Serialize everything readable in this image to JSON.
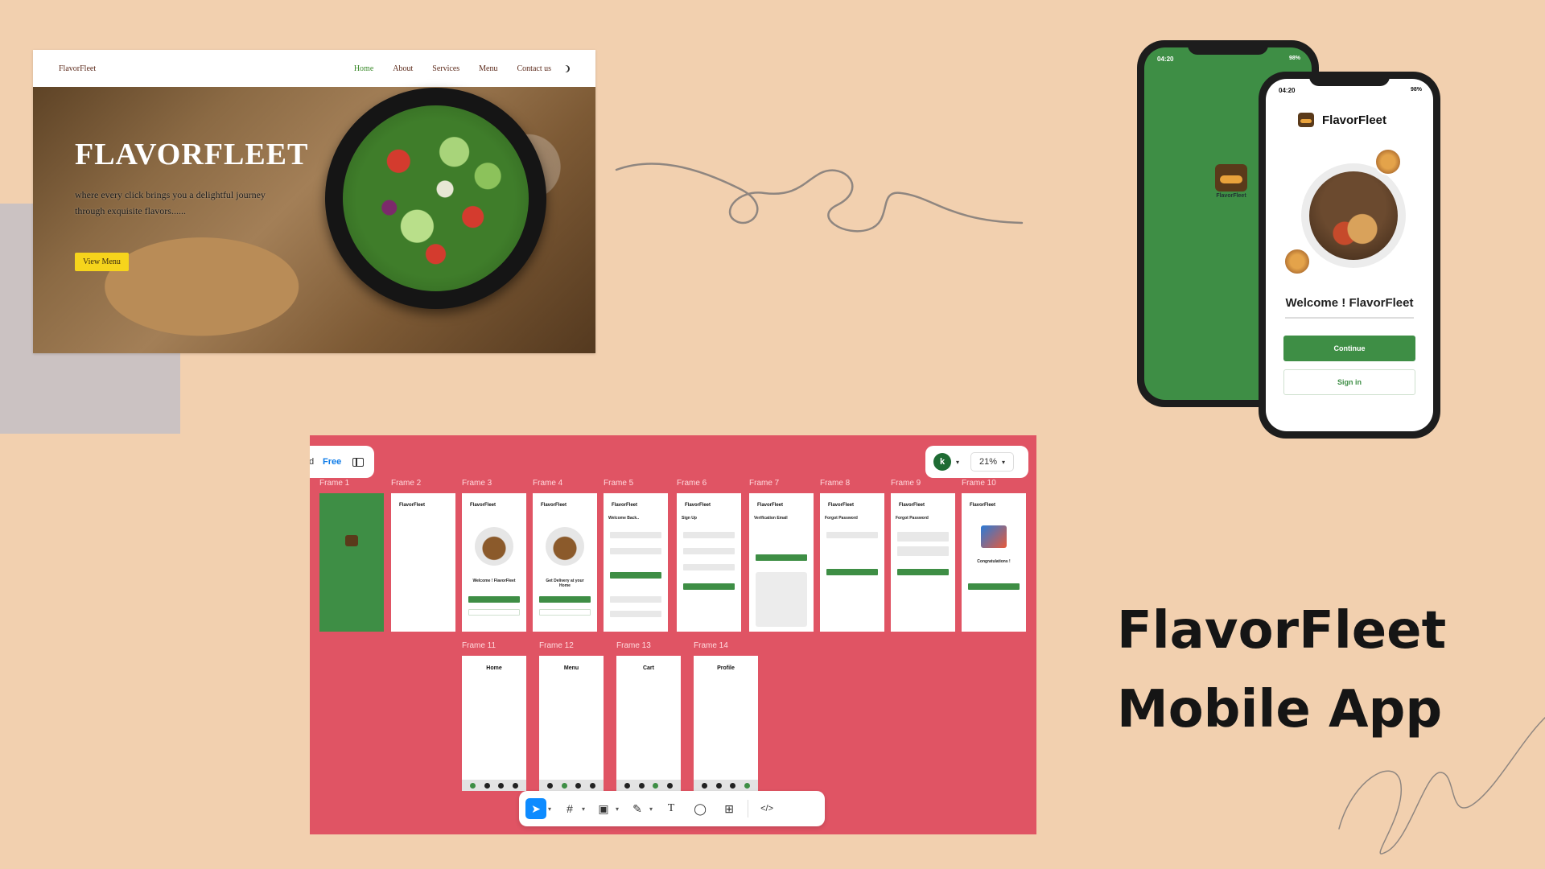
{
  "website": {
    "logo": "FlavorFleet",
    "nav": [
      "Home",
      "About",
      "Services",
      "Menu",
      "Contact us"
    ],
    "hero_title": "FLAVORFLEET",
    "hero_subtitle": "where every click brings you a delightful journey through exquisite flavors......",
    "hero_button": "View Menu"
  },
  "phone_splash": {
    "time": "04:20",
    "battery": "98%",
    "brand": "FlavorFleet"
  },
  "phone_welcome": {
    "time": "04:20",
    "battery": "98%",
    "app_title": "FlavorFleet",
    "welcome_text": "Welcome ! FlavorFleet",
    "continue_button": "Continue",
    "signin_button": "Sign in"
  },
  "headline": {
    "line1": "FlavorFleet",
    "line2": "Mobile App"
  },
  "figma": {
    "plan": "Free",
    "cropped_letter": "d",
    "avatar_initial": "k",
    "zoom": "21%",
    "frames_row1": [
      {
        "label": "Frame 1"
      },
      {
        "label": "Frame 2"
      },
      {
        "label": "Frame 3"
      },
      {
        "label": "Frame 4"
      },
      {
        "label": "Frame 5"
      },
      {
        "label": "Frame 6"
      },
      {
        "label": "Frame 7"
      },
      {
        "label": "Frame 8"
      },
      {
        "label": "Frame 9"
      },
      {
        "label": "Frame 10"
      }
    ],
    "frames_row2": [
      {
        "label": "Frame 11",
        "title": "Home"
      },
      {
        "label": "Frame 12",
        "title": "Menu"
      },
      {
        "label": "Frame 13",
        "title": "Cart"
      },
      {
        "label": "Frame 14",
        "title": "Profile"
      }
    ],
    "frame_texts": {
      "app_name": "FlavorFleet",
      "welcome": "Welcome ! FlavorFleet",
      "delivery": "Get Delivery at your Home",
      "welcome_back": "Welcome Back..",
      "sign_up": "Sign Up",
      "verification": "Verification Email",
      "forgot": "Forgot Password",
      "congrats": "Congratulations !"
    }
  },
  "colors": {
    "background": "#f2d0af",
    "brand_green": "#3e8e45",
    "canvas_red": "#e05464",
    "accent_yellow": "#f6d41c"
  }
}
